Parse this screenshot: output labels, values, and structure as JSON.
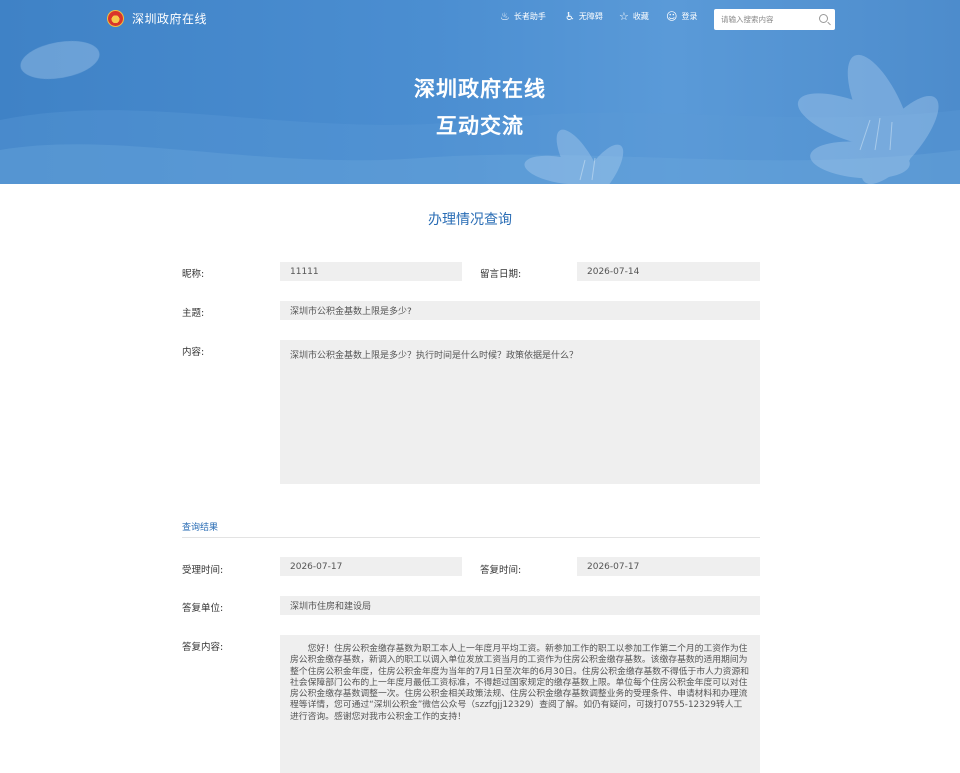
{
  "header": {
    "site_name": "深圳政府在线",
    "nav": {
      "elder": "长者助手",
      "access": "无障碍",
      "favorite": "收藏",
      "login": "登录"
    },
    "search_placeholder": "请输入搜索内容",
    "hero_line1": "深圳政府在线",
    "hero_line2": "互动交流"
  },
  "query": {
    "section_title": "办理情况查询",
    "nickname_label": "昵称:",
    "nickname_value": "11111",
    "date_label": "留言日期:",
    "date_value": "2026-07-14",
    "subject_label": "主题:",
    "subject_value": "深圳市公积金基数上限是多少?",
    "content_label": "内容:",
    "content_value": "深圳市公积金基数上限是多少？执行时间是什么时候？政策依据是什么？"
  },
  "result": {
    "title": "查询结果",
    "accept_time_label": "受理时间:",
    "accept_time_value": "2026-07-17",
    "reply_time_label": "答复时间:",
    "reply_time_value": "2026-07-17",
    "reply_unit_label": "答复单位:",
    "reply_unit_value": "深圳市住房和建设局",
    "reply_content_label": "答复内容:",
    "reply_content_value": "您好！住房公积金缴存基数为职工本人上一年度月平均工资。新参加工作的职工以参加工作第二个月的工资作为住房公积金缴存基数，新调入的职工以调入单位发放工资当月的工资作为住房公积金缴存基数。该缴存基数的适用期间为整个住房公积金年度，住房公积金年度为当年的7月1日至次年的6月30日。住房公积金缴存基数不得低于市人力资源和社会保障部门公布的上一年度月最低工资标准，不得超过国家规定的缴存基数上限。单位每个住房公积金年度可以对住房公积金缴存基数调整一次。住房公积金相关政策法规、住房公积金缴存基数调整业务的受理条件、申请材料和办理流程等详情，您可通过“深圳公积金”微信公众号（szzfgjj12329）查阅了解。如仍有疑问，可拨打0755-12329转人工进行咨询。感谢您对我市公积金工作的支持！"
  },
  "colors": {
    "hero_blue": "#4b8ed1",
    "accent_blue": "#2a6db5",
    "field_gray": "#efefef"
  }
}
